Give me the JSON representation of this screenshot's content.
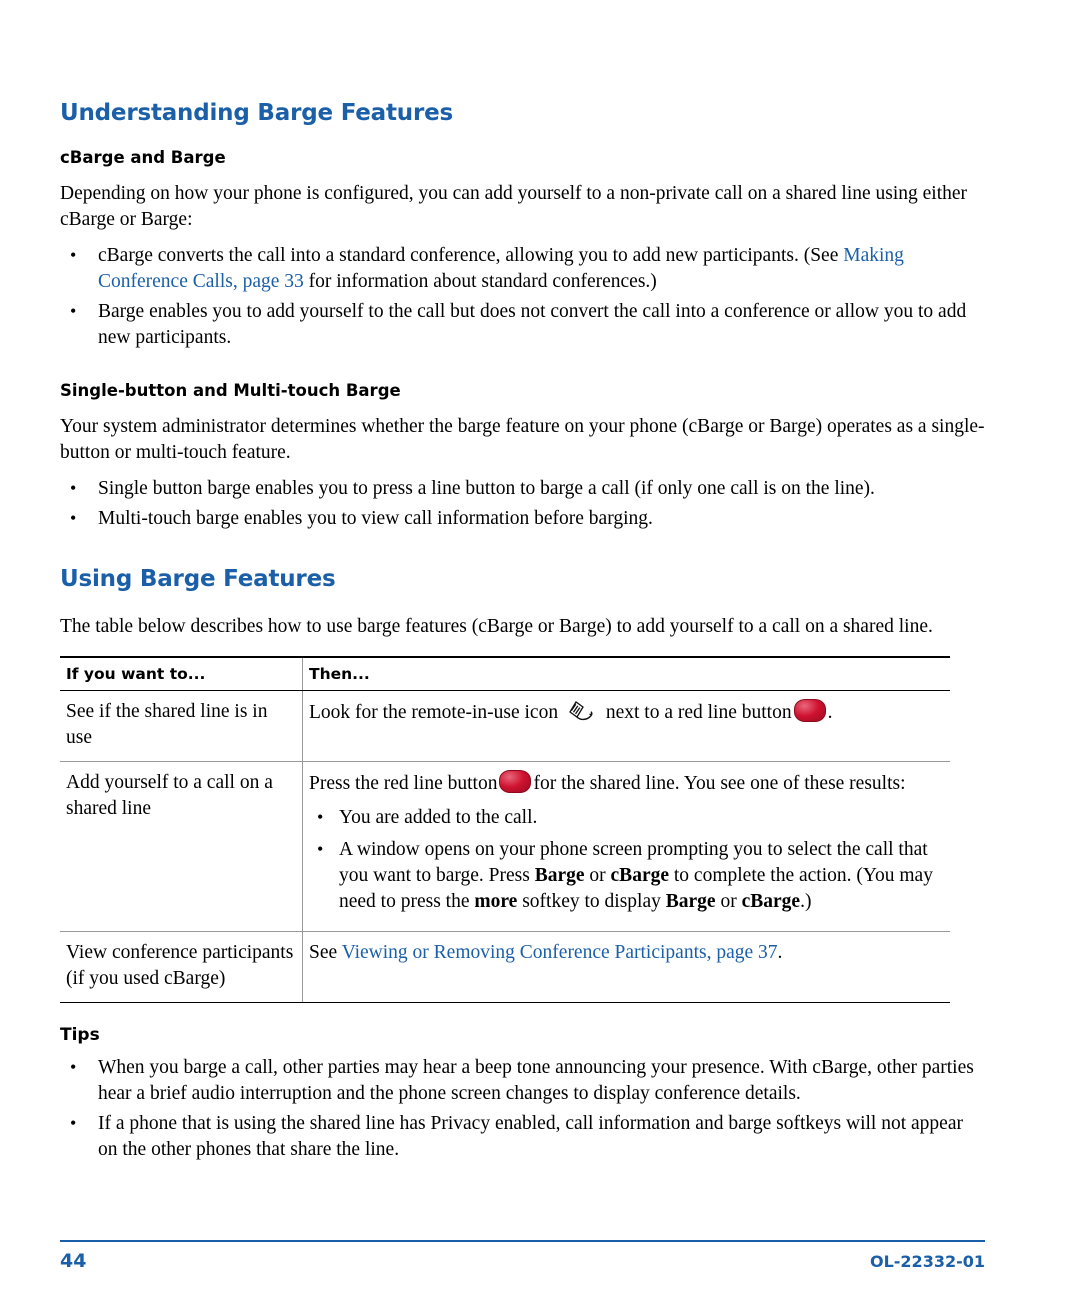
{
  "document": {
    "heading1": "Understanding Barge Features",
    "sub1": "cBarge and Barge",
    "para1": "Depending on how your phone is configured, you can add yourself to a non-private call on a shared line using either cBarge or Barge:",
    "bullet1a_pre": "cBarge converts the call into a standard conference, allowing you to add new participants. (See ",
    "bullet1a_link": "Making Conference Calls, page 33",
    "bullet1a_post": " for information about standard conferences.)",
    "bullet1b": "Barge enables you to add yourself to the call but does not convert the call into a conference or allow you to add new participants.",
    "sub2": "Single-button and Multi-touch Barge",
    "para2": "Your system administrator determines whether the barge feature on your phone (cBarge or Barge) operates as a single-button or multi-touch feature.",
    "bullet2a": "Single button barge enables you to press a line button to barge a call (if only one call is on the line).",
    "bullet2b": "Multi-touch barge enables you to view call information before barging.",
    "heading2": "Using Barge Features",
    "para3": "The table below describes how to use barge features (cBarge or Barge) to add yourself to a call on a shared line.",
    "table": {
      "headers": [
        "If you want to...",
        "Then..."
      ],
      "rows": [
        {
          "col1": "See if the shared line is in use",
          "then_pre": "Look for the remote-in-use icon",
          "then_mid": "next to a red line button",
          "then_post": ".",
          "icons": [
            "remote-in-use-icon",
            "red-line-button-icon"
          ]
        },
        {
          "col1": "Add yourself to a call on a shared line",
          "then_pre": "Press the red line button",
          "then_mid": "for the shared line. You see one of these results:",
          "sub_bullets": [
            "You are added to the call.",
            "A window opens on your phone screen prompting you to select the call that you want to barge. Press Barge or cBarge to complete the action. (You may need to press the more softkey to display Barge or cBarge.)"
          ]
        },
        {
          "col1": "View conference participants (if you used cBarge)",
          "then_pre": "See ",
          "then_link": "Viewing or Removing Conference Participants, page 37",
          "then_post": "."
        }
      ]
    },
    "tips_title": "Tips",
    "tips": [
      "When you barge a call, other parties may hear a beep tone announcing your presence. With cBarge, other parties hear a brief audio interruption and the phone screen changes to display conference details.",
      "If a phone that is using the shared line has Privacy enabled, call information and barge softkeys will not appear on the other phones that share the line."
    ],
    "footer": {
      "page_number": "44",
      "doc_id": "OL-22332-01"
    },
    "colors": {
      "heading_blue": "#1a5fa8",
      "link_blue": "#1a5fa8",
      "button_red": "#cf1230"
    }
  }
}
